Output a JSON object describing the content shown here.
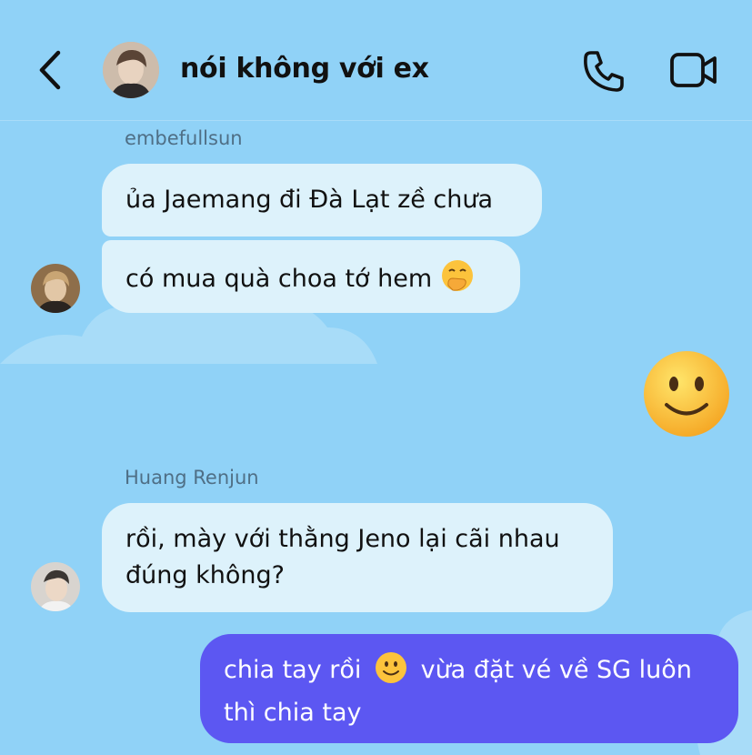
{
  "header": {
    "title": "nói không với ex",
    "back_icon": "chevron-left-icon",
    "call_icon": "phone-icon",
    "video_icon": "video-camera-icon"
  },
  "messages": [
    {
      "sender": "embefullsun",
      "lines": [
        "ủa Jaemang đi Đà Lạt zề chưa",
        "có mua quà choa tớ hem"
      ],
      "emoji": "hand-over-mouth-emoji"
    },
    {
      "sender_self_emoji": "slightly-smiling-face-emoji"
    },
    {
      "sender": "Huang Renjun",
      "line1": "rồi, mày với thằng Jeno lại cãi nhau",
      "line2": "đúng không?"
    },
    {
      "self_line1_a": "chia tay rồi",
      "self_line1_b": "vừa đặt vé về SG luôn",
      "self_line2": "thì chia tay"
    }
  ],
  "colors": {
    "background": "#90d2f7",
    "received_bubble": "#ddf2fb",
    "sent_bubble": "#5c57f2"
  }
}
